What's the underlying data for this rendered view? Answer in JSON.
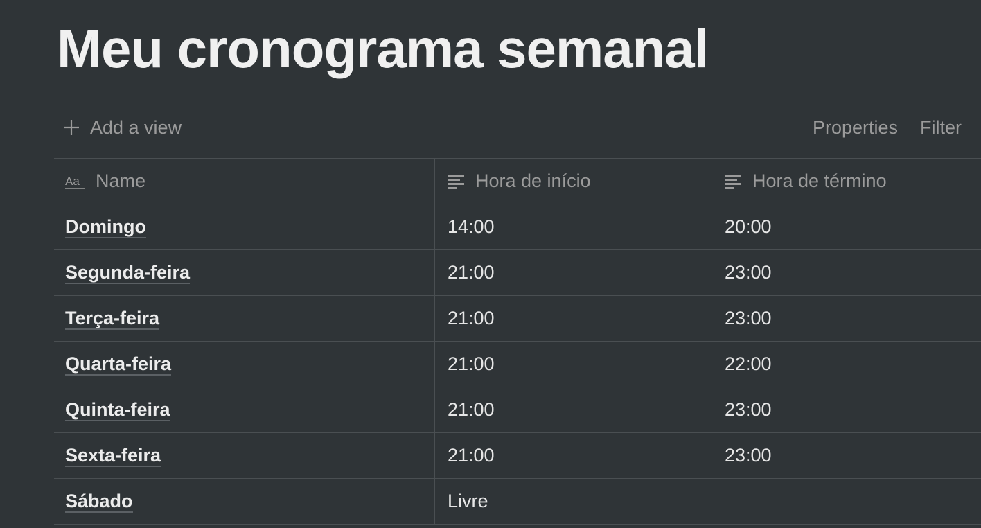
{
  "page": {
    "title": "Meu cronograma semanal"
  },
  "viewbar": {
    "add_view_label": "Add a view",
    "properties_label": "Properties",
    "filter_label": "Filter"
  },
  "table": {
    "columns": [
      {
        "label": "Name",
        "icon": "text-title-icon"
      },
      {
        "label": "Hora de início",
        "icon": "text-lines-icon"
      },
      {
        "label": "Hora de término",
        "icon": "text-lines-icon"
      }
    ],
    "rows": [
      {
        "name": "Domingo",
        "start": "14:00",
        "end": "20:00"
      },
      {
        "name": "Segunda-feira",
        "start": "21:00",
        "end": "23:00"
      },
      {
        "name": "Terça-feira",
        "start": "21:00",
        "end": "23:00"
      },
      {
        "name": "Quarta-feira",
        "start": "21:00",
        "end": "22:00"
      },
      {
        "name": "Quinta-feira",
        "start": "21:00",
        "end": "23:00"
      },
      {
        "name": "Sexta-feira",
        "start": "21:00",
        "end": "23:00"
      },
      {
        "name": "Sábado",
        "start": "Livre",
        "end": ""
      }
    ]
  },
  "colors": {
    "background": "#2f3437",
    "text": "#ebebeb",
    "muted": "#9b9b9b",
    "border": "#4a4f52"
  }
}
